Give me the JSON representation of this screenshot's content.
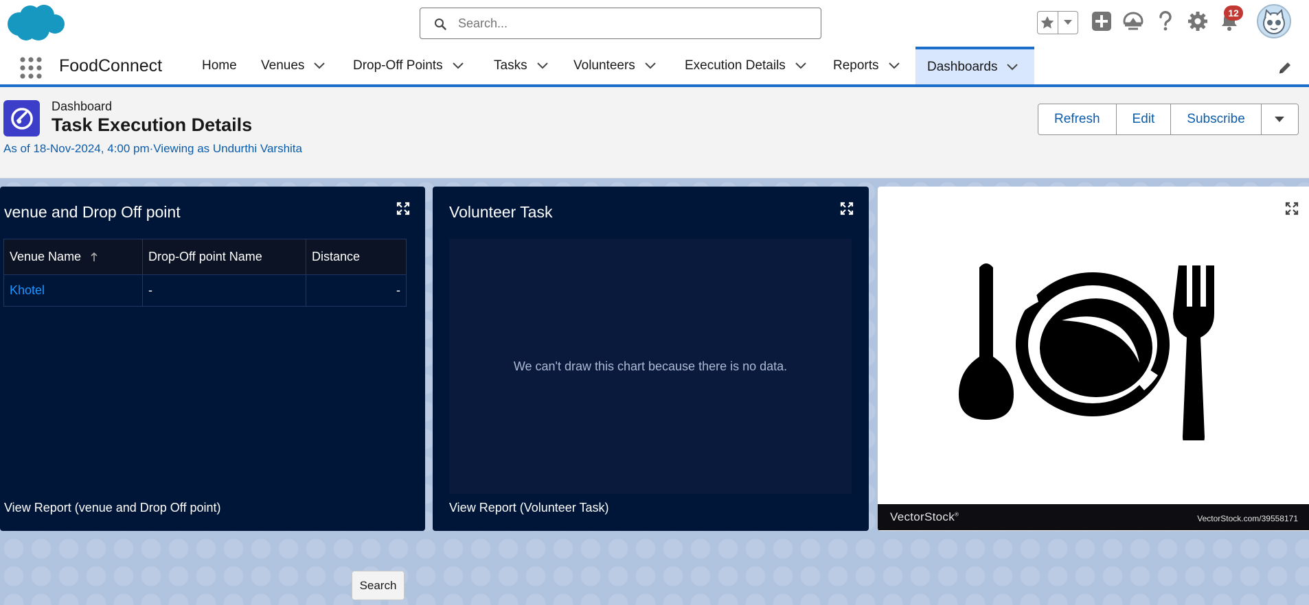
{
  "search": {
    "placeholder": "Search..."
  },
  "header_icons": [
    "favorites-star-icon",
    "favorites-list-chevron-icon",
    "global-add-icon",
    "trailhead-guide-icon",
    "help-icon",
    "setup-gear-icon",
    "notification-bell-icon"
  ],
  "notifications": {
    "count": "12"
  },
  "app": {
    "name": "FoodConnect"
  },
  "nav": {
    "items": [
      {
        "label": "Home"
      },
      {
        "label": "Venues"
      },
      {
        "label": "Drop-Off Points"
      },
      {
        "label": "Tasks"
      },
      {
        "label": "Volunteers"
      },
      {
        "label": "Execution Details"
      },
      {
        "label": "Reports"
      },
      {
        "label": "Dashboards"
      }
    ],
    "active": "Dashboards"
  },
  "page": {
    "eyebrow": "Dashboard",
    "title": "Task Execution Details",
    "as_of": "As of 18-Nov-2024, 4:00 pm·Viewing as Undurthi Varshita",
    "buttons": {
      "refresh": "Refresh",
      "edit": "Edit",
      "subscribe": "Subscribe"
    }
  },
  "widgets": {
    "venue": {
      "title": "venue and Drop Off point",
      "columns": [
        "Venue Name",
        "Drop-Off point Name",
        "Distance"
      ],
      "rows": [
        {
          "venue": "Khotel",
          "dropoff": "-",
          "distance": "-"
        }
      ],
      "footer": "View Report (venue and Drop Off point)"
    },
    "volunteer": {
      "title": "Volunteer Task",
      "no_data": "We can't draw this chart because there is no data.",
      "footer": "View Report (Volunteer Task)"
    },
    "image": {
      "brand": "VectorStock",
      "brand_mark": "®",
      "stock_id": "VectorStock.com/39558171"
    }
  },
  "bottom": {
    "search_button": "Search"
  },
  "colors": {
    "accent": "#1b6ec9",
    "dashboard_icon": "#3c3ec9",
    "widget_bg": "#001639",
    "link": "#1b96ff",
    "badge": "#c23934"
  }
}
